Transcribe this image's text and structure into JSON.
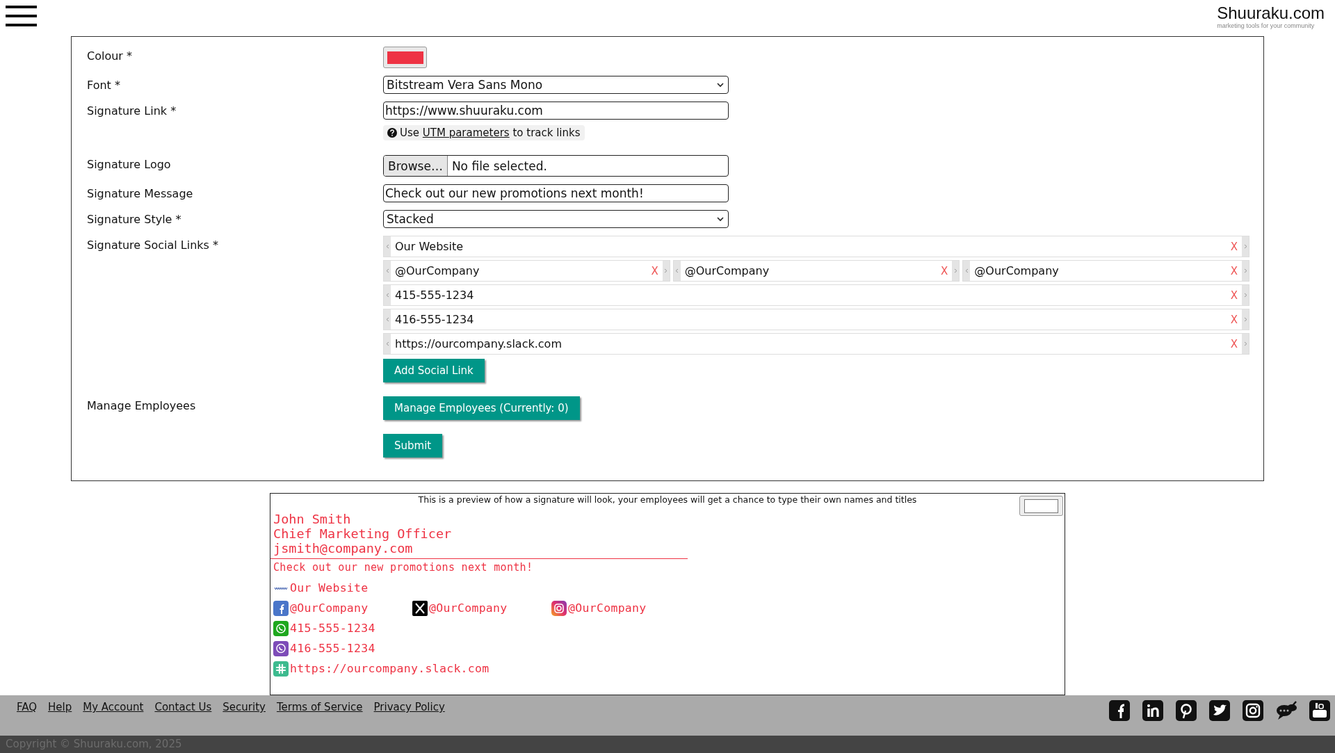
{
  "header": {
    "site_name": "Shuuraku.com",
    "tagline": "marketing tools for your community"
  },
  "form": {
    "fields": [
      {
        "kind": "colour",
        "label": "Colour *",
        "color": "#ee3344"
      },
      {
        "kind": "select",
        "label": "Font *",
        "value": "Bitstream Vera Sans Mono"
      },
      {
        "kind": "text",
        "label": "Signature Link *",
        "value": "https://www.shuuraku.com",
        "hint": {
          "before": "Use ",
          "link": "UTM parameters",
          "after": " to track links"
        }
      },
      {
        "kind": "file",
        "label": "Signature Logo",
        "button": "Browse…",
        "status": "No file selected."
      },
      {
        "kind": "text",
        "label": "Signature Message",
        "value": "Check out our new promotions next month!"
      },
      {
        "kind": "select",
        "label": "Signature Style *",
        "value": "Stacked"
      },
      {
        "kind": "social",
        "label": "Signature Social Links *",
        "add_button": "Add Social Link",
        "rows": [
          [
            {
              "value": "Our Website",
              "remove": "X"
            }
          ],
          [
            {
              "value": "@OurCompany",
              "remove": "X"
            },
            {
              "value": "@OurCompany",
              "remove": "X"
            },
            {
              "value": "@OurCompany",
              "remove": "X"
            }
          ],
          [
            {
              "value": "415-555-1234",
              "remove": "X"
            }
          ],
          [
            {
              "value": "416-555-1234",
              "remove": "X"
            }
          ],
          [
            {
              "value": "https://ourcompany.slack.com",
              "remove": "X"
            }
          ]
        ]
      },
      {
        "kind": "button",
        "label": "Manage Employees",
        "button": "Manage Employees (Currently: 0)"
      },
      {
        "kind": "button",
        "button": "Submit"
      }
    ]
  },
  "preview": {
    "note": "This is a preview of how a signature will look, your employees will get a chance to type their own names and titles",
    "name": "John Smith",
    "title": "Chief Marketing Officer",
    "email": "jsmith@company.com",
    "message": "Check out our new promotions next month!",
    "links": [
      [
        {
          "kind": "website",
          "text": "Our Website"
        }
      ],
      [
        {
          "kind": "facebook",
          "text": "@OurCompany"
        },
        {
          "kind": "x",
          "text": "@OurCompany"
        },
        {
          "kind": "instagram",
          "text": "@OurCompany"
        }
      ],
      [
        {
          "kind": "whatsapp",
          "text": "415-555-1234"
        }
      ],
      [
        {
          "kind": "viber",
          "text": "416-555-1234"
        }
      ],
      [
        {
          "kind": "slack",
          "text": "https://ourcompany.slack.com"
        }
      ]
    ]
  },
  "footer": {
    "links": [
      "FAQ",
      "Help",
      "My Account",
      "Contact Us",
      "Security",
      "Terms of Service",
      "Privacy Policy"
    ],
    "copyright": "Copyright © Shuuraku.com, 2025"
  }
}
